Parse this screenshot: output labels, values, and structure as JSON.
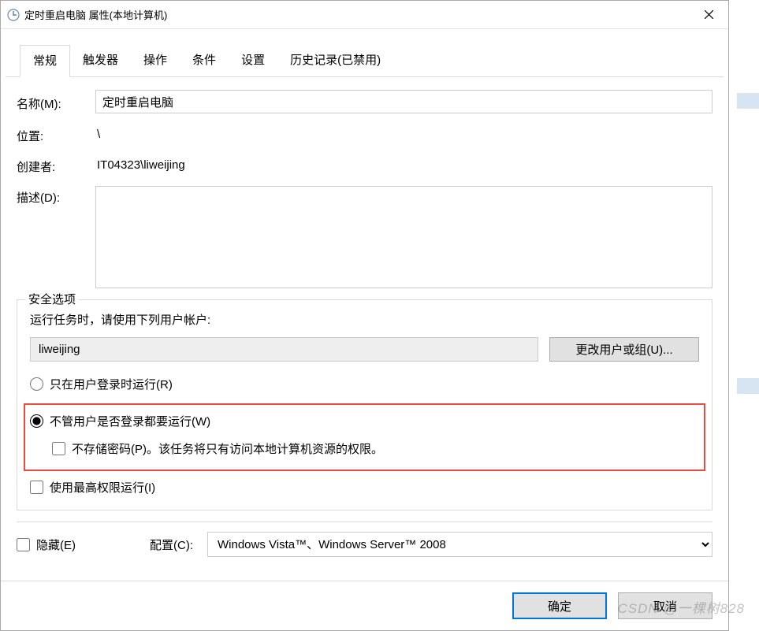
{
  "window": {
    "title": "定时重启电脑 属性(本地计算机)"
  },
  "tabs": [
    {
      "label": "常规",
      "active": true
    },
    {
      "label": "触发器",
      "active": false
    },
    {
      "label": "操作",
      "active": false
    },
    {
      "label": "条件",
      "active": false
    },
    {
      "label": "设置",
      "active": false
    },
    {
      "label": "历史记录(已禁用)",
      "active": false
    }
  ],
  "general": {
    "name_label": "名称(M):",
    "name_value": "定时重启电脑",
    "location_label": "位置:",
    "location_value": "\\",
    "author_label": "创建者:",
    "author_value": "IT04323\\liweijing",
    "description_label": "描述(D):",
    "description_value": ""
  },
  "security": {
    "legend": "安全选项",
    "run_as_text": "运行任务时，请使用下列用户帐户:",
    "user_account": "liweijing",
    "change_user_label": "更改用户或组(U)...",
    "radio_logged_on": "只在用户登录时运行(R)",
    "radio_any": "不管用户是否登录都要运行(W)",
    "no_store_password": "不存储密码(P)。该任务将只有访问本地计算机资源的权限。",
    "highest_priv": "使用最高权限运行(I)"
  },
  "config": {
    "hidden_label": "隐藏(E)",
    "configure_for_label": "配置(C):",
    "configure_for_value": "Windows Vista™、Windows Server™ 2008"
  },
  "footer": {
    "ok": "确定",
    "cancel": "取消"
  },
  "watermark": "CSDN @一棵树828"
}
